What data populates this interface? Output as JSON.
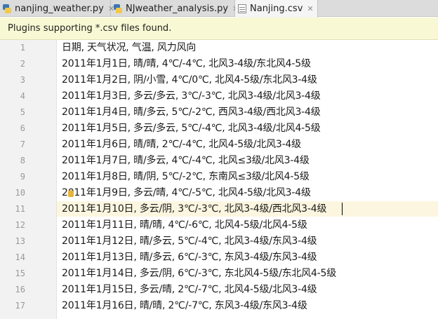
{
  "tabs": [
    {
      "label": "nanjing_weather.py",
      "icon": "python-file-icon",
      "active": false
    },
    {
      "label": "NJweather_analysis.py",
      "icon": "python-file-icon",
      "active": false
    },
    {
      "label": "Nanjing.csv",
      "icon": "csv-file-icon",
      "active": true
    }
  ],
  "tab_close_glyph": "✕",
  "notice": "Plugins supporting *.csv files found.",
  "current_line": 11,
  "lines": [
    {
      "n": "1",
      "text": "日期, 天气状况, 气温, 风力风向"
    },
    {
      "n": "2",
      "text": "2011年1月1日, 晴/晴, 4℃/-4℃, 北风3-4级/东北风4-5级"
    },
    {
      "n": "3",
      "text": "2011年1月2日, 阴/小雪, 4℃/0℃, 北风4-5级/东北风3-4级"
    },
    {
      "n": "4",
      "text": "2011年1月3日, 多云/多云, 3℃/-3℃, 北风3-4级/北风3-4级"
    },
    {
      "n": "5",
      "text": "2011年1月4日, 晴/多云, 5℃/-2℃, 西风3-4级/西北风3-4级"
    },
    {
      "n": "6",
      "text": "2011年1月5日, 多云/多云, 5℃/-4℃, 北风3-4级/北风4-5级"
    },
    {
      "n": "7",
      "text": "2011年1月6日, 晴/晴, 2℃/-4℃, 北风4-5级/北风3-4级"
    },
    {
      "n": "8",
      "text": "2011年1月7日, 晴/多云, 4℃/-4℃, 北风≤3级/北风3-4级"
    },
    {
      "n": "9",
      "text": "2011年1月8日, 晴/阴, 5℃/-2℃, 东南风≤3级/北风4-5级"
    },
    {
      "n": "10",
      "text": "2011年1月9日, 多云/晴, 4℃/-5℃, 北风4-5级/北风3-4级"
    },
    {
      "n": "11",
      "text": "2011年1月10日, 多云/阴, 3℃/-3℃, 北风3-4级/西北风3-4级"
    },
    {
      "n": "12",
      "text": "2011年1月11日, 晴/晴, 4℃/-6℃, 北风4-5级/北风4-5级"
    },
    {
      "n": "13",
      "text": "2011年1月12日, 晴/多云, 5℃/-4℃, 北风3-4级/东风3-4级"
    },
    {
      "n": "14",
      "text": "2011年1月13日, 晴/多云, 6℃/-3℃, 东风3-4级/东风3-4级"
    },
    {
      "n": "15",
      "text": "2011年1月14日, 多云/阴, 6℃/-3℃, 东北风4-5级/东北风4-5级"
    },
    {
      "n": "16",
      "text": "2011年1月15日, 多云/晴, 2℃/-7℃, 北风4-5级/北风3-4级"
    },
    {
      "n": "17",
      "text": "2011年1月16日, 晴/晴, 2℃/-7℃, 东风3-4级/东风3-4级"
    }
  ]
}
